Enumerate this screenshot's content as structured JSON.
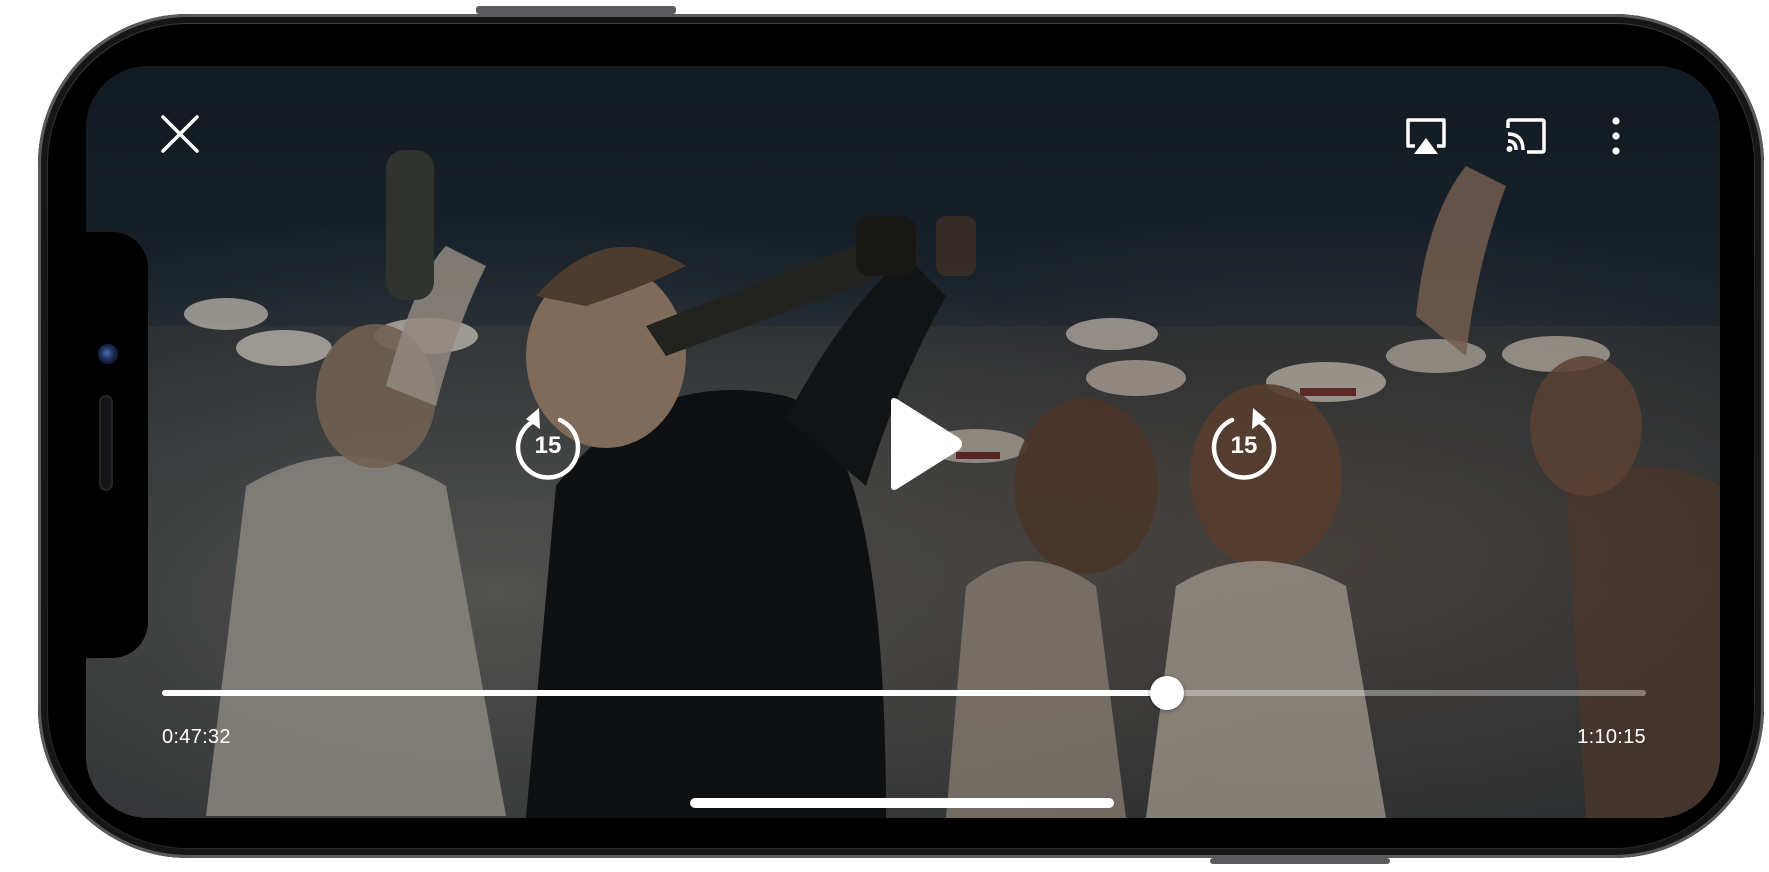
{
  "player": {
    "state": "paused",
    "skip_back_seconds": "15",
    "skip_forward_seconds": "15",
    "elapsed_time": "0:47:32",
    "total_time": "1:10:15",
    "progress_fraction": 0.677
  },
  "icons": {
    "close": "close-icon",
    "airplay": "airplay-icon",
    "cast": "cast-icon",
    "more": "more-vertical-icon",
    "skip_back": "rewind-15-icon",
    "play": "play-icon",
    "skip_forward": "forward-15-icon"
  },
  "colors": {
    "controls": "#ffffff",
    "track_inactive": "rgba(255,255,255,0.35)",
    "phone_frame": "#2b2b2d"
  }
}
